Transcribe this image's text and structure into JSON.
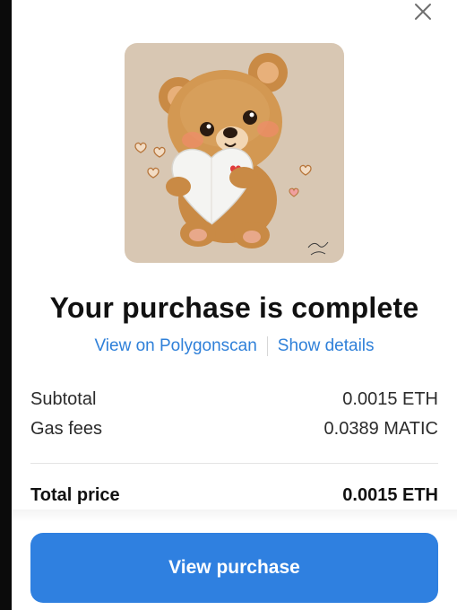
{
  "dialog": {
    "title": "Your purchase is complete",
    "close_icon": "close-icon"
  },
  "nft": {
    "image_icon": "teddy-bear-heart-illustration",
    "background_color": "#d8c7b3"
  },
  "links": {
    "explorer": "View on Polygonscan",
    "details": "Show details"
  },
  "summary": {
    "subtotal_label": "Subtotal",
    "subtotal_value": "0.0015 ETH",
    "gas_label": "Gas fees",
    "gas_value": "0.0389 MATIC",
    "total_label": "Total price",
    "total_value": "0.0015 ETH"
  },
  "actions": {
    "primary_label": "View purchase"
  },
  "colors": {
    "accent": "#2f80e0",
    "link": "#2f80d9"
  }
}
